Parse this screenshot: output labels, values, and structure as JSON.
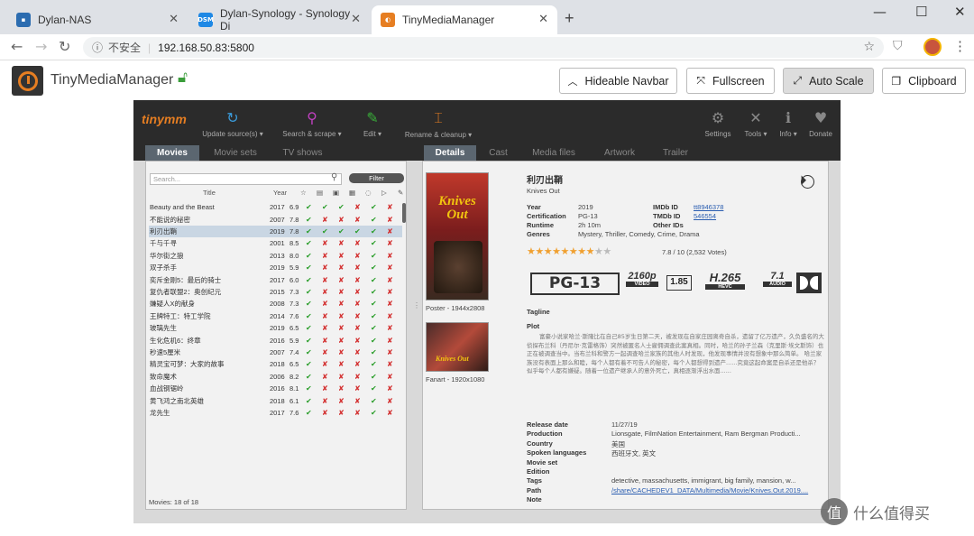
{
  "browser": {
    "tabs": [
      {
        "title": "Dylan-NAS",
        "icon": "nas-favicon",
        "color": "#2b6cb0"
      },
      {
        "title": "Dylan-Synology - Synology Di",
        "icon": "dsm-favicon",
        "color": "#1e88e5",
        "badge": "DSM"
      },
      {
        "title": "TinyMediaManager",
        "icon": "tmm-favicon",
        "color": "#e67e22"
      }
    ],
    "new_tab": "+",
    "security": "不安全",
    "url": "192.168.50.83:5800"
  },
  "app_header": {
    "title": "TinyMediaManager",
    "buttons": [
      "Hideable Navbar",
      "Fullscreen",
      "Auto Scale",
      "Clipboard"
    ],
    "active_button": "Auto Scale"
  },
  "toolbar": {
    "brand": "tinymm",
    "tools": [
      {
        "label": "Update source(s)",
        "icon": "refresh-icon",
        "color": "#3a9ad9"
      },
      {
        "label": "Search & scrape",
        "icon": "search-icon",
        "color": "#c040c0"
      },
      {
        "label": "Edit",
        "icon": "pencil-icon",
        "color": "#3ab03a"
      },
      {
        "label": "Rename & cleanup",
        "icon": "rename-icon",
        "color": "#e67e22"
      }
    ],
    "right_tools": [
      "Settings",
      "Tools",
      "Info",
      "Donate"
    ]
  },
  "left_tabs": [
    "Movies",
    "Movie sets",
    "TV shows"
  ],
  "search_placeholder": "Search...",
  "filter_label": "Filter",
  "columns": {
    "title": "Title",
    "year": "Year"
  },
  "movies": [
    {
      "title": "Beauty and the Beast",
      "year": "2017",
      "rating": "6.9",
      "flags": "gggrgr"
    },
    {
      "title": "不能说的秘密",
      "year": "2007",
      "rating": "7.8",
      "flags": "grrrgr"
    },
    {
      "title": "利刃出鞘",
      "year": "2019",
      "rating": "7.8",
      "flags": "gggggr"
    },
    {
      "title": "千与千寻",
      "year": "2001",
      "rating": "8.5",
      "flags": "grrrgr"
    },
    {
      "title": "华尔街之狼",
      "year": "2013",
      "rating": "8.0",
      "flags": "grrrgr"
    },
    {
      "title": "双子杀手",
      "year": "2019",
      "rating": "5.9",
      "flags": "grrrgr"
    },
    {
      "title": "奕斥金刚5：最后的骑士",
      "year": "2017",
      "rating": "6.0",
      "flags": "grrrgr"
    },
    {
      "title": "复仇者联盟2：奥创纪元",
      "year": "2015",
      "rating": "7.3",
      "flags": "grrrgr"
    },
    {
      "title": "嫌疑人X的献身",
      "year": "2008",
      "rating": "7.3",
      "flags": "grrrgr"
    },
    {
      "title": "王牌特工：特工学院",
      "year": "2014",
      "rating": "7.6",
      "flags": "grrrgr"
    },
    {
      "title": "玻璃先生",
      "year": "2019",
      "rating": "6.5",
      "flags": "grrrgr"
    },
    {
      "title": "生化危机6：终章",
      "year": "2016",
      "rating": "5.9",
      "flags": "grrrgr"
    },
    {
      "title": "秒速5厘米",
      "year": "2007",
      "rating": "7.4",
      "flags": "grrrgr"
    },
    {
      "title": "精灵宝可梦：大家的故事",
      "year": "2018",
      "rating": "6.5",
      "flags": "grrrgr"
    },
    {
      "title": "致命魔术",
      "year": "2006",
      "rating": "8.2",
      "flags": "grrrgr"
    },
    {
      "title": "血战钢锯岭",
      "year": "2016",
      "rating": "8.1",
      "flags": "grrrgr"
    },
    {
      "title": "黄飞鸿之南北英雄",
      "year": "2018",
      "rating": "6.1",
      "flags": "grrrgr"
    },
    {
      "title": "龙先生",
      "year": "2017",
      "rating": "7.6",
      "flags": "grrrgr"
    }
  ],
  "movies_count": "Movies: 18 of 18",
  "detail_tabs": [
    "Details",
    "Cast",
    "Media files",
    "Artwork",
    "Trailer"
  ],
  "detail": {
    "title": "利刃出鞘",
    "original_title": "Knives Out",
    "poster_caption": "Poster - 1944x2808",
    "fanart_caption": "Fanart - 1920x1080",
    "poster_text": "Knives Out",
    "fields": [
      {
        "label": "Year",
        "value": "2019"
      },
      {
        "label": "Certification",
        "value": "PG-13"
      },
      {
        "label": "Runtime",
        "value": "2h 10m"
      },
      {
        "label": "Genres",
        "value": "Mystery, Thriller, Comedy, Crime, Drama"
      }
    ],
    "ids": [
      {
        "label": "IMDb ID",
        "value": "tt8946378"
      },
      {
        "label": "TMDb ID",
        "value": "546554"
      },
      {
        "label": "Other IDs",
        "value": ""
      }
    ],
    "rating_text": "7.8 / 10  (2,532 Votes)",
    "stars": 7.8,
    "badges": {
      "cert": "PG-13",
      "video": "2160p",
      "video_sub": "VIDEO",
      "aspect": "1.85",
      "codec": "H.265",
      "codec_sub": "HEVC",
      "audio": "7.1",
      "audio_sub": "AUDIO"
    },
    "tagline_label": "Tagline",
    "plot_label": "Plot",
    "plot": "富豪小说家哈兰·斯隆比在自己85岁生日第二天，被发现在自家庄园离奇自杀，遗留了亿万遗产，久负盛名的大侦探布兰科（丹尼尔·克雷格饰）突然被匿名人士雇佣调查此案真相。同时，哈兰的孙子兰森（克里斯·埃文斯饰）也正在被调查当中。当布兰科和警方一起调查哈兰家族的其他人时发现，他发现事情并没有想象中那么简单。 哈兰家族没有表面上那么和睦，每个人都有着不可告人的秘密，每个人都想得到遗产......究竟这起命案是自杀还是他杀？似乎每个人都有嫌疑。随着一位遗产继承人的意外死亡，真相逐渐浮出水面......",
    "meta": [
      {
        "label": "Release date",
        "value": "11/27/19"
      },
      {
        "label": "Production",
        "value": "Lionsgate, FilmNation Entertainment, Ram Bergman Producti..."
      },
      {
        "label": "Country",
        "value": "美国"
      },
      {
        "label": "Spoken languages",
        "value": "西班牙文, 英文"
      },
      {
        "label": "Movie set",
        "value": ""
      },
      {
        "label": "Edition",
        "value": ""
      },
      {
        "label": "Tags",
        "value": "detective, massachusetts, immigrant, big family, mansion, w..."
      },
      {
        "label": "Path",
        "value": "/share/CACHEDEV1_DATA/Multimedia/Movie/Knives.Out.2019...."
      },
      {
        "label": "Note",
        "value": ""
      }
    ]
  },
  "watermark": "值 什么值得买"
}
